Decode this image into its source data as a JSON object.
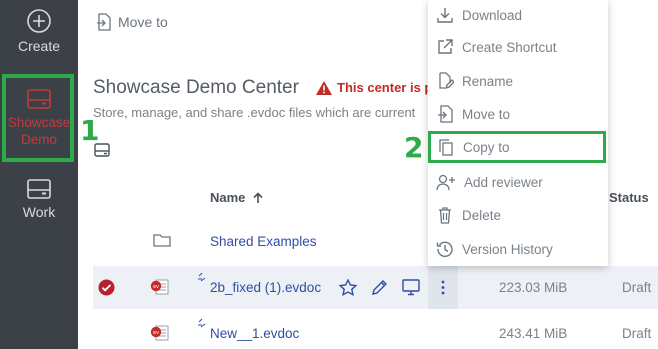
{
  "sidebar": {
    "create_label": "Create",
    "showcase_label": "Showcase\nDemo",
    "work_label": "Work"
  },
  "badges": {
    "one": "1",
    "two": "2"
  },
  "toolbar": {
    "move_to_label": "Move to"
  },
  "center": {
    "title": "Showcase Demo Center",
    "warning": "This center is p",
    "subtitle": "Store, manage, and share .evdoc files which are current"
  },
  "table": {
    "headers": {
      "name": "Name",
      "status": "Status"
    },
    "rows": [
      {
        "name": "Shared Examples",
        "size": "",
        "status": ""
      },
      {
        "name": "2b_fixed (1).evdoc",
        "size": "223.03 MiB",
        "status": "Draft"
      },
      {
        "name": "New__1.evdoc",
        "size": "243.41 MiB",
        "status": "Draft"
      }
    ]
  },
  "context_menu": {
    "items": [
      "Download",
      "Create Shortcut",
      "Rename",
      "Move to",
      "Copy to",
      "Add reviewer",
      "Delete",
      "Version History"
    ]
  },
  "colors": {
    "sidebar_bg": "#3c4147",
    "highlight_green": "#2eaa4a",
    "link_blue": "#2f4da5",
    "warning_red": "#c22b2b"
  }
}
